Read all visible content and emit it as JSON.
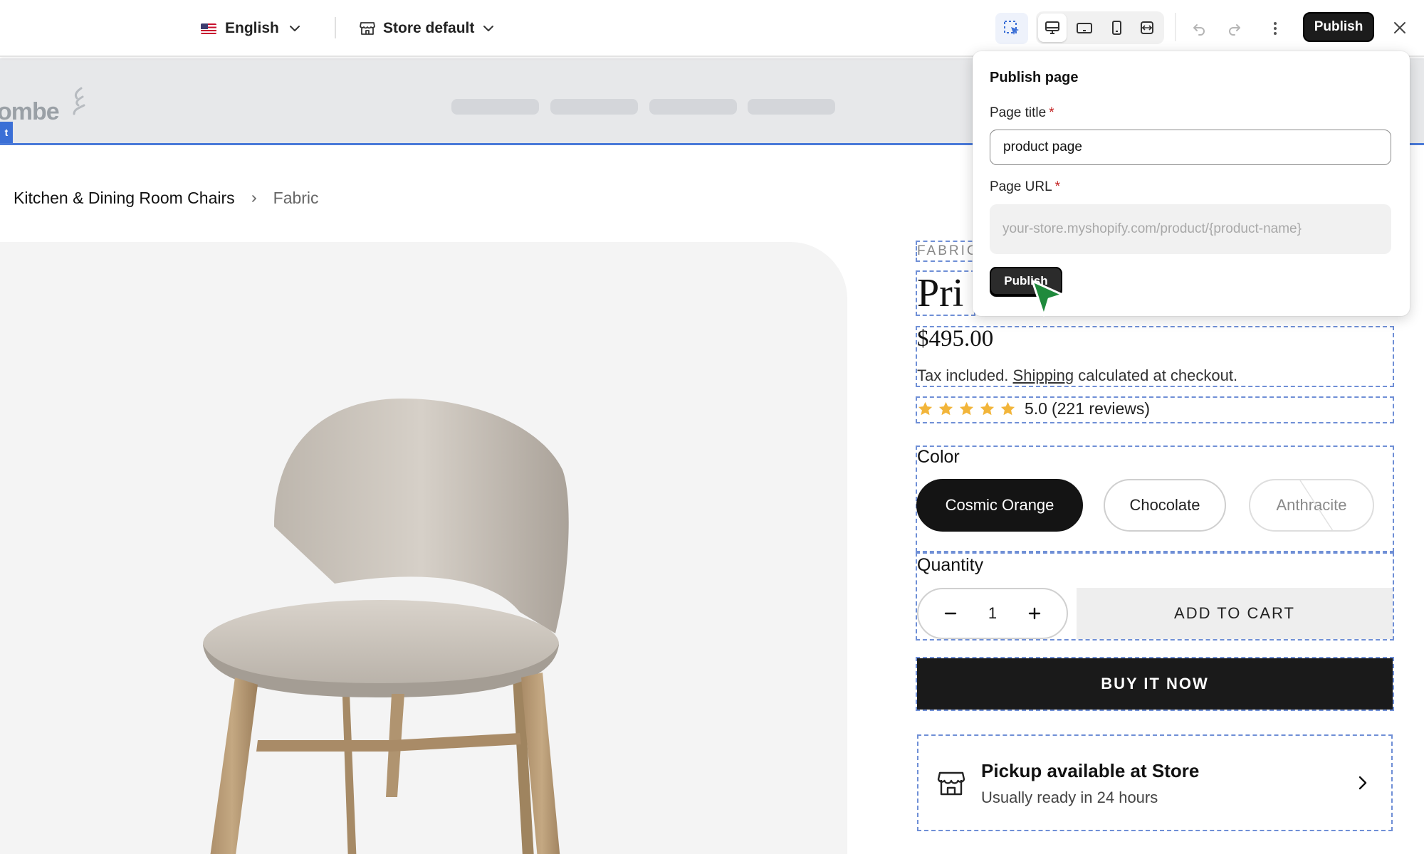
{
  "toolbar": {
    "language": "English",
    "store": "Store default",
    "publish_label": "Publish"
  },
  "breadcrumb": {
    "parent": "Kitchen & Dining Room Chairs",
    "current": "Fabric"
  },
  "store_header": {
    "logo_text": "ombe",
    "edge_tag": "t"
  },
  "product": {
    "vendor": "FABRIC",
    "title": "Pri",
    "price": "$495.00",
    "tax_prefix": "Tax included. ",
    "shipping_link": "Shipping",
    "tax_suffix": " calculated at checkout.",
    "rating": "5.0",
    "reviews": "(221 reviews)",
    "color_label": "Color",
    "colors": [
      "Cosmic Orange",
      "Chocolate",
      "Anthracite"
    ],
    "selected_color": "Cosmic Orange",
    "quantity_label": "Quantity",
    "quantity": "1",
    "add_to_cart": "ADD TO CART",
    "buy_now": "BUY IT NOW",
    "pickup_title": "Pickup available at Store",
    "pickup_subtitle": "Usually ready in 24 hours",
    "star_color": "#F2B53A"
  },
  "publish_popover": {
    "heading": "Publish page",
    "title_label": "Page title",
    "title_value": "product page",
    "url_label": "Page URL",
    "url_placeholder": "your-store.myshopify.com/product/{product-name}",
    "required_mark": "*",
    "button": "Publish"
  },
  "colors": {
    "accent_blue": "#3B6FD6",
    "dark_button": "#1A1A1A",
    "cursor_green": "#1F8A3C"
  }
}
